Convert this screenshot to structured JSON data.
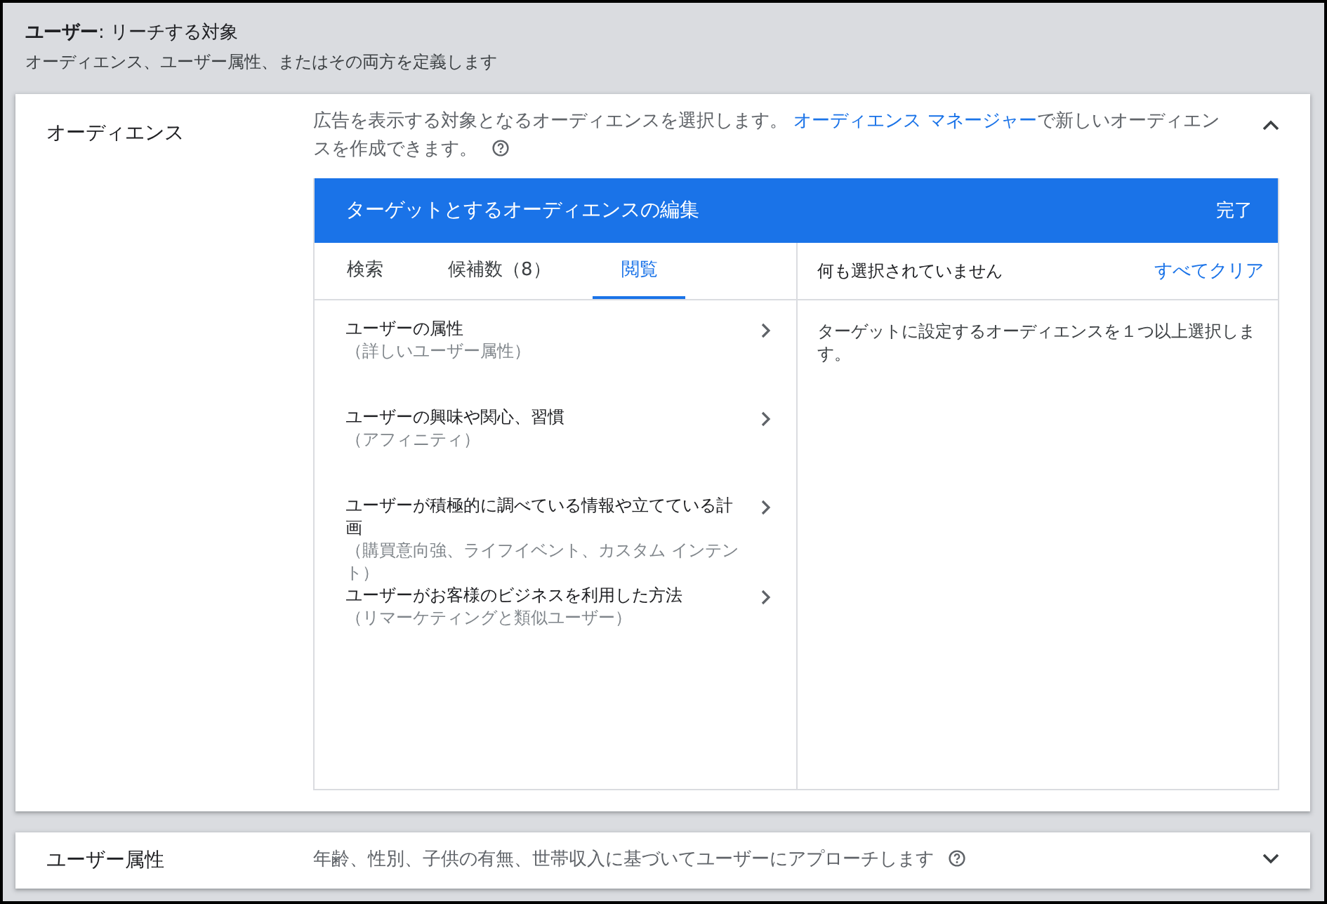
{
  "header": {
    "title": "**ユーザー**: リーチする対象",
    "subtitle": "オーディエンス、ユーザー属性、またはその両方を定義します"
  },
  "sections": [
    {
      "label": "オーディエンス",
      "description": "広告を表示する対象となるオーディエンスを選択します。 ",
      "link": "オーディエンス マネージャー",
      "description_after": "で新しいオーディエンスを作成できます。",
      "expanded": true,
      "editor": {
        "title": "ターゲットとするオーディエンスの編集",
        "done_button": "完了",
        "tabs": [
          {
            "label": "検索",
            "selected": false
          },
          {
            "label": "候補数（8）",
            "selected": false
          },
          {
            "label": "閲覧",
            "selected": true
          }
        ],
        "categories": [
          {
            "title": "ユーザーの属性",
            "subtitle": "（詳しいユーザー属性）"
          },
          {
            "title": "ユーザーの興味や関心、習慣",
            "subtitle": "（アフィニティ）"
          },
          {
            "title": "ユーザーが積極的に調べている情報や立てている計画",
            "subtitle": "（購買意向強、ライフイベント、カスタム インテント）"
          },
          {
            "title": "ユーザーがお客様のビジネスを利用した方法",
            "subtitle": "（リマーケティングと類似ユーザー）"
          }
        ],
        "selection": {
          "status": "何も選択されていません",
          "clear_link": "すべてクリア",
          "message": "ターゲットに設定するオーディエンスを１つ以上選択します。"
        }
      }
    },
    {
      "label": "ユーザー属性",
      "description": "年齢、性別、子供の有無、世帯収入に基づいてユーザーにアプローチします",
      "expanded": false
    }
  ]
}
